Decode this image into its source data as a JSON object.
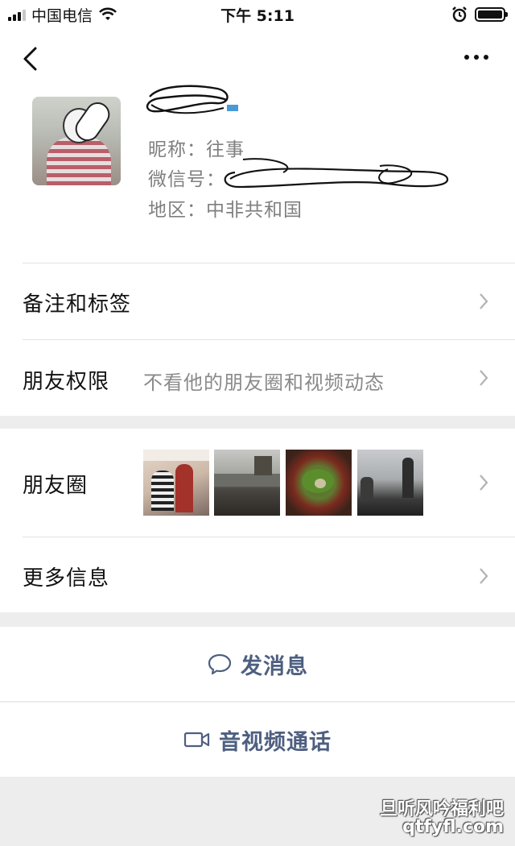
{
  "status_bar": {
    "carrier": "中国电信",
    "time": "下午 5:11"
  },
  "profile": {
    "nickname_label": "昵称：往事",
    "wechat_id_label": "微信号：",
    "region_label": "地区：中非共和国"
  },
  "rows": {
    "remarks_label": "备注和标签",
    "permissions_label": "朋友权限",
    "permissions_value": "不看他的朋友圈和视频动态",
    "moments_label": "朋友圈",
    "more_info_label": "更多信息"
  },
  "actions": {
    "send_message": "发消息",
    "video_call": "音视频通话"
  },
  "watermark": {
    "line1": "旦听风吟福利吧",
    "line2": "qtfyfl.com"
  },
  "colors": {
    "action_text": "#4e5f80",
    "background": "#ededed"
  }
}
